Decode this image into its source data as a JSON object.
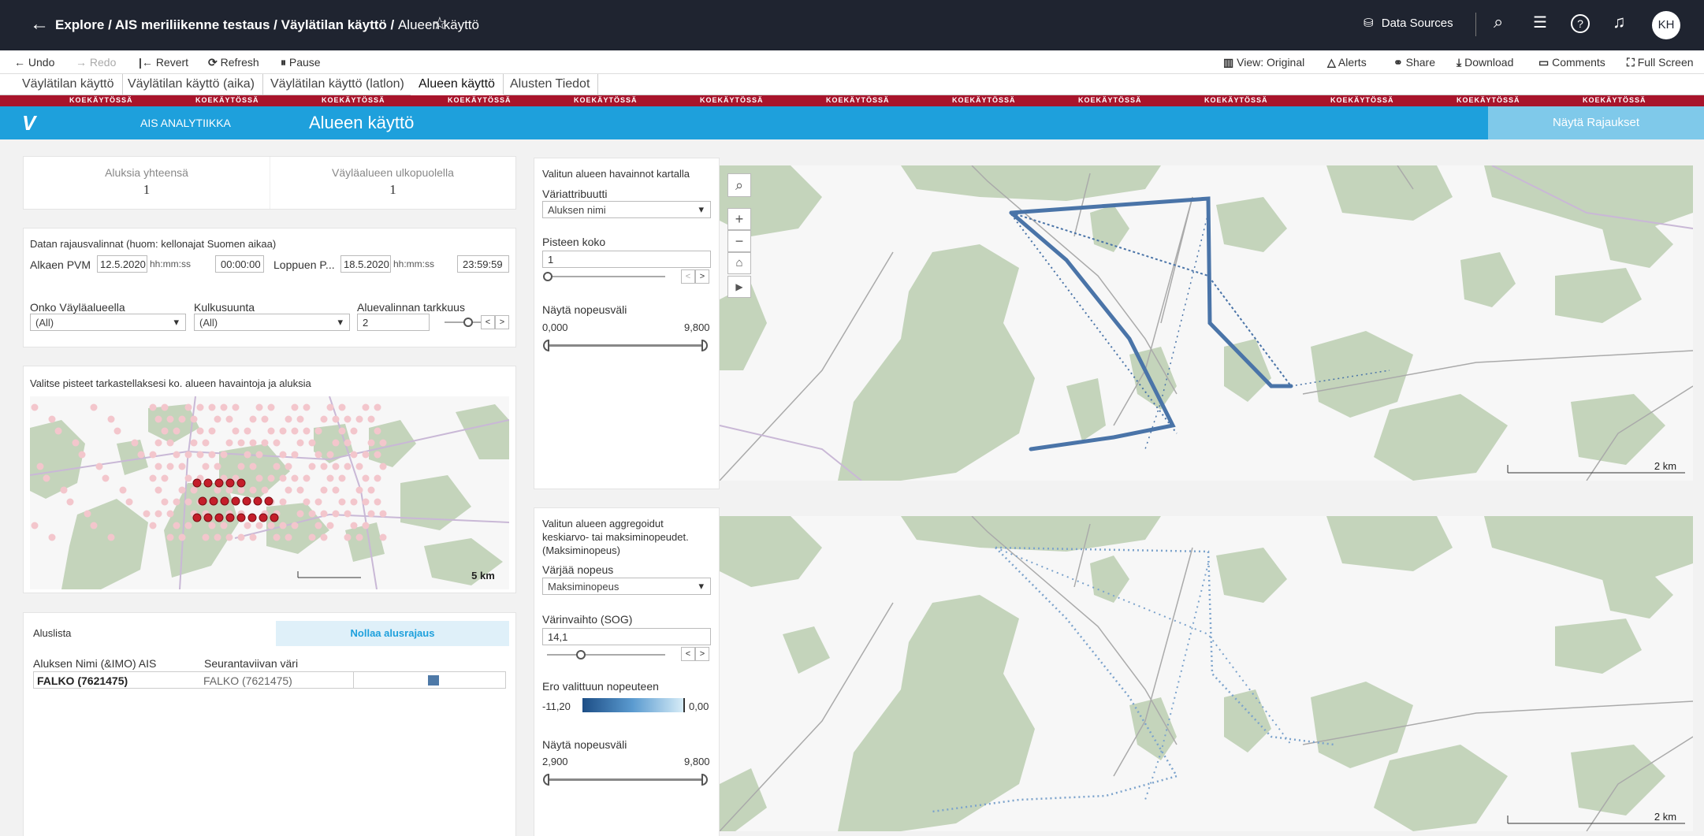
{
  "topbar": {
    "crumb_explore": "Explore",
    "crumb_project": "AIS meriliikenne testaus",
    "crumb_workbook": "Väylätilan käyttö",
    "crumb_view": "Alueen käyttö",
    "data_sources": "Data Sources",
    "avatar": "KH"
  },
  "toolbar": {
    "undo": "Undo",
    "redo": "Redo",
    "revert": "Revert",
    "refresh": "Refresh",
    "pause": "Pause",
    "view_original": "View: Original",
    "alerts": "Alerts",
    "share": "Share",
    "download": "Download",
    "comments": "Comments",
    "full_screen": "Full Screen"
  },
  "tabs": [
    "Väylätilan käyttö",
    "Väylätilan käyttö (aika)",
    "Väylätilan käyttö (latlon)",
    "Alueen käyttö",
    "Alusten Tiedot"
  ],
  "banner_text": "KOEKÄYTÖSSÄ",
  "header": {
    "logo": "V",
    "app_name": "AIS ANALYTIIKKA",
    "page_title": "Alueen käyttö",
    "show_filters": "Näytä Rajaukset"
  },
  "kpis": {
    "total_label": "Aluksia yhteensä",
    "total_value": "1",
    "outside_label": "Väyläalueen ulkopuolella",
    "outside_value": "1"
  },
  "filters": {
    "title": "Datan rajausvalinnat (huom: kellonajat Suomen aikaa)",
    "start_label": "Alkaen PVM",
    "start_date": "12.5.2020",
    "time_hint": "hh:mm:ss",
    "start_time": "00:00:00",
    "end_label": "Loppuen P...",
    "end_date": "18.5.2020",
    "end_time": "23:59:59",
    "in_fairway_label": "Onko Väyläalueella",
    "in_fairway_value": "(All)",
    "direction_label": "Kulkusuunta",
    "direction_value": "(All)",
    "precision_label": "Aluevalinnan tarkkuus",
    "precision_value": "2"
  },
  "selector": {
    "title": "Valitse pisteet tarkastellaksesi ko. alueen havaintoja ja aluksia",
    "scale": "5 km"
  },
  "vessel_list": {
    "title": "Aluslista",
    "reset_button": "Nollaa alusrajaus",
    "col_name": "Aluksen Nimi (&IMO) AIS",
    "col_color": "Seurantaviivan väri",
    "rows": [
      {
        "name": "FALKO (7621475)",
        "color_label": "FALKO (7621475)",
        "swatch": "#4e79a7"
      }
    ]
  },
  "map1_panel": {
    "title": "Valitun alueen havainnot kartalla",
    "color_attr_label": "Väriattribuutti",
    "color_attr_value": "Aluksen nimi",
    "point_size_label": "Pisteen koko",
    "point_size_value": "1",
    "speed_range_label": "Näytä nopeusväli",
    "speed_min": "0,000",
    "speed_max": "9,800",
    "scale": "2 km"
  },
  "map2_panel": {
    "title_line1": "Valitun alueen aggregoidut",
    "title_line2": "keskiarvo- tai maksiminopeudet.",
    "title_line3": "(Maksiminopeus)",
    "color_speed_label": "Värjää nopeus",
    "color_speed_value": "Maksiminopeus",
    "color_change_label": "Värinvaihto (SOG)",
    "color_change_value": "14,1",
    "diff_label": "Ero valittuun nopeuteen",
    "diff_min": "-11,20",
    "diff_max": "0,00",
    "speed_range_label": "Näytä nopeusväli",
    "speed_min": "2,900",
    "speed_max": "9,800",
    "scale": "2 km"
  },
  "colors": {
    "track": "#4a74a8",
    "header_blue": "#1ea0dc",
    "banner_red": "#a8142b",
    "land": "#c4d4bb"
  }
}
